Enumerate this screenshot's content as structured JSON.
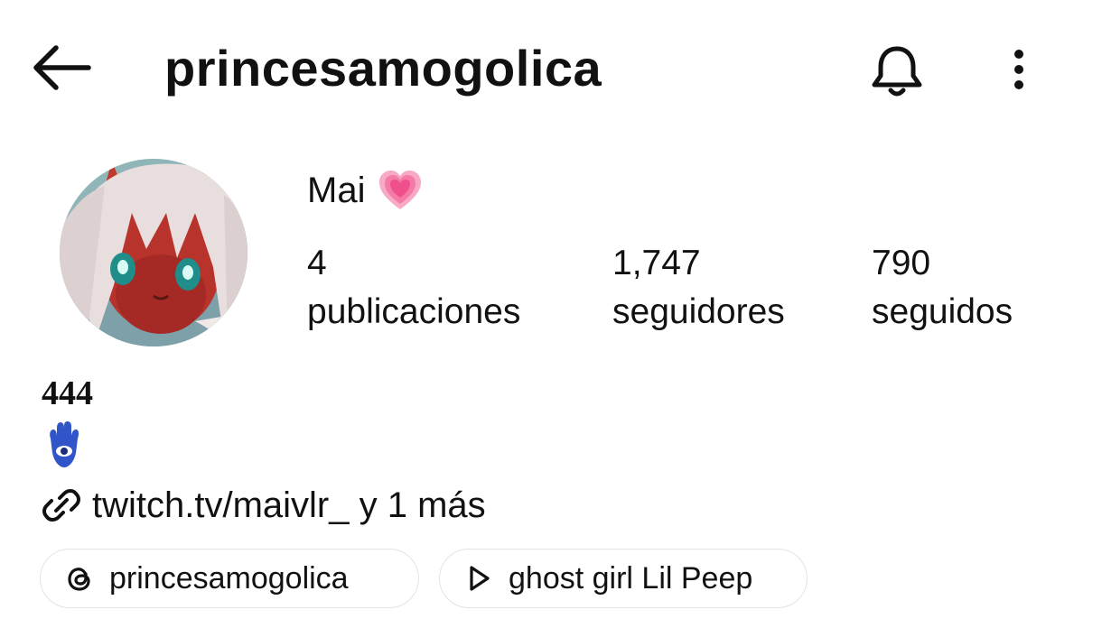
{
  "header": {
    "username": "princesamogolica",
    "back_icon": "arrow-left-icon",
    "notifications_icon": "bell-icon",
    "more_icon": "more-vertical-icon"
  },
  "profile": {
    "display_name": "Mai",
    "name_emoji_icon": "growing-heart-icon",
    "stats": {
      "posts": {
        "count": "4",
        "label": "publicaciones"
      },
      "followers": {
        "count": "1,747",
        "label": "seguidores"
      },
      "following": {
        "count": "790",
        "label": "seguidos"
      }
    },
    "bio": {
      "line1": "444",
      "line2_icon": "hamsa-icon"
    },
    "link": {
      "icon": "link-icon",
      "text": "twitch.tv/maivlr_ y 1 más"
    }
  },
  "chips": [
    {
      "icon": "threads-icon",
      "label": "princesamogolica"
    },
    {
      "icon": "play-icon",
      "label": "ghost girl Lil Peep"
    }
  ],
  "colors": {
    "text": "#111111",
    "background": "#ffffff",
    "chip_border": "#e3e3e3",
    "heart": "#f2558f",
    "hamsa": "#2f55c9"
  }
}
